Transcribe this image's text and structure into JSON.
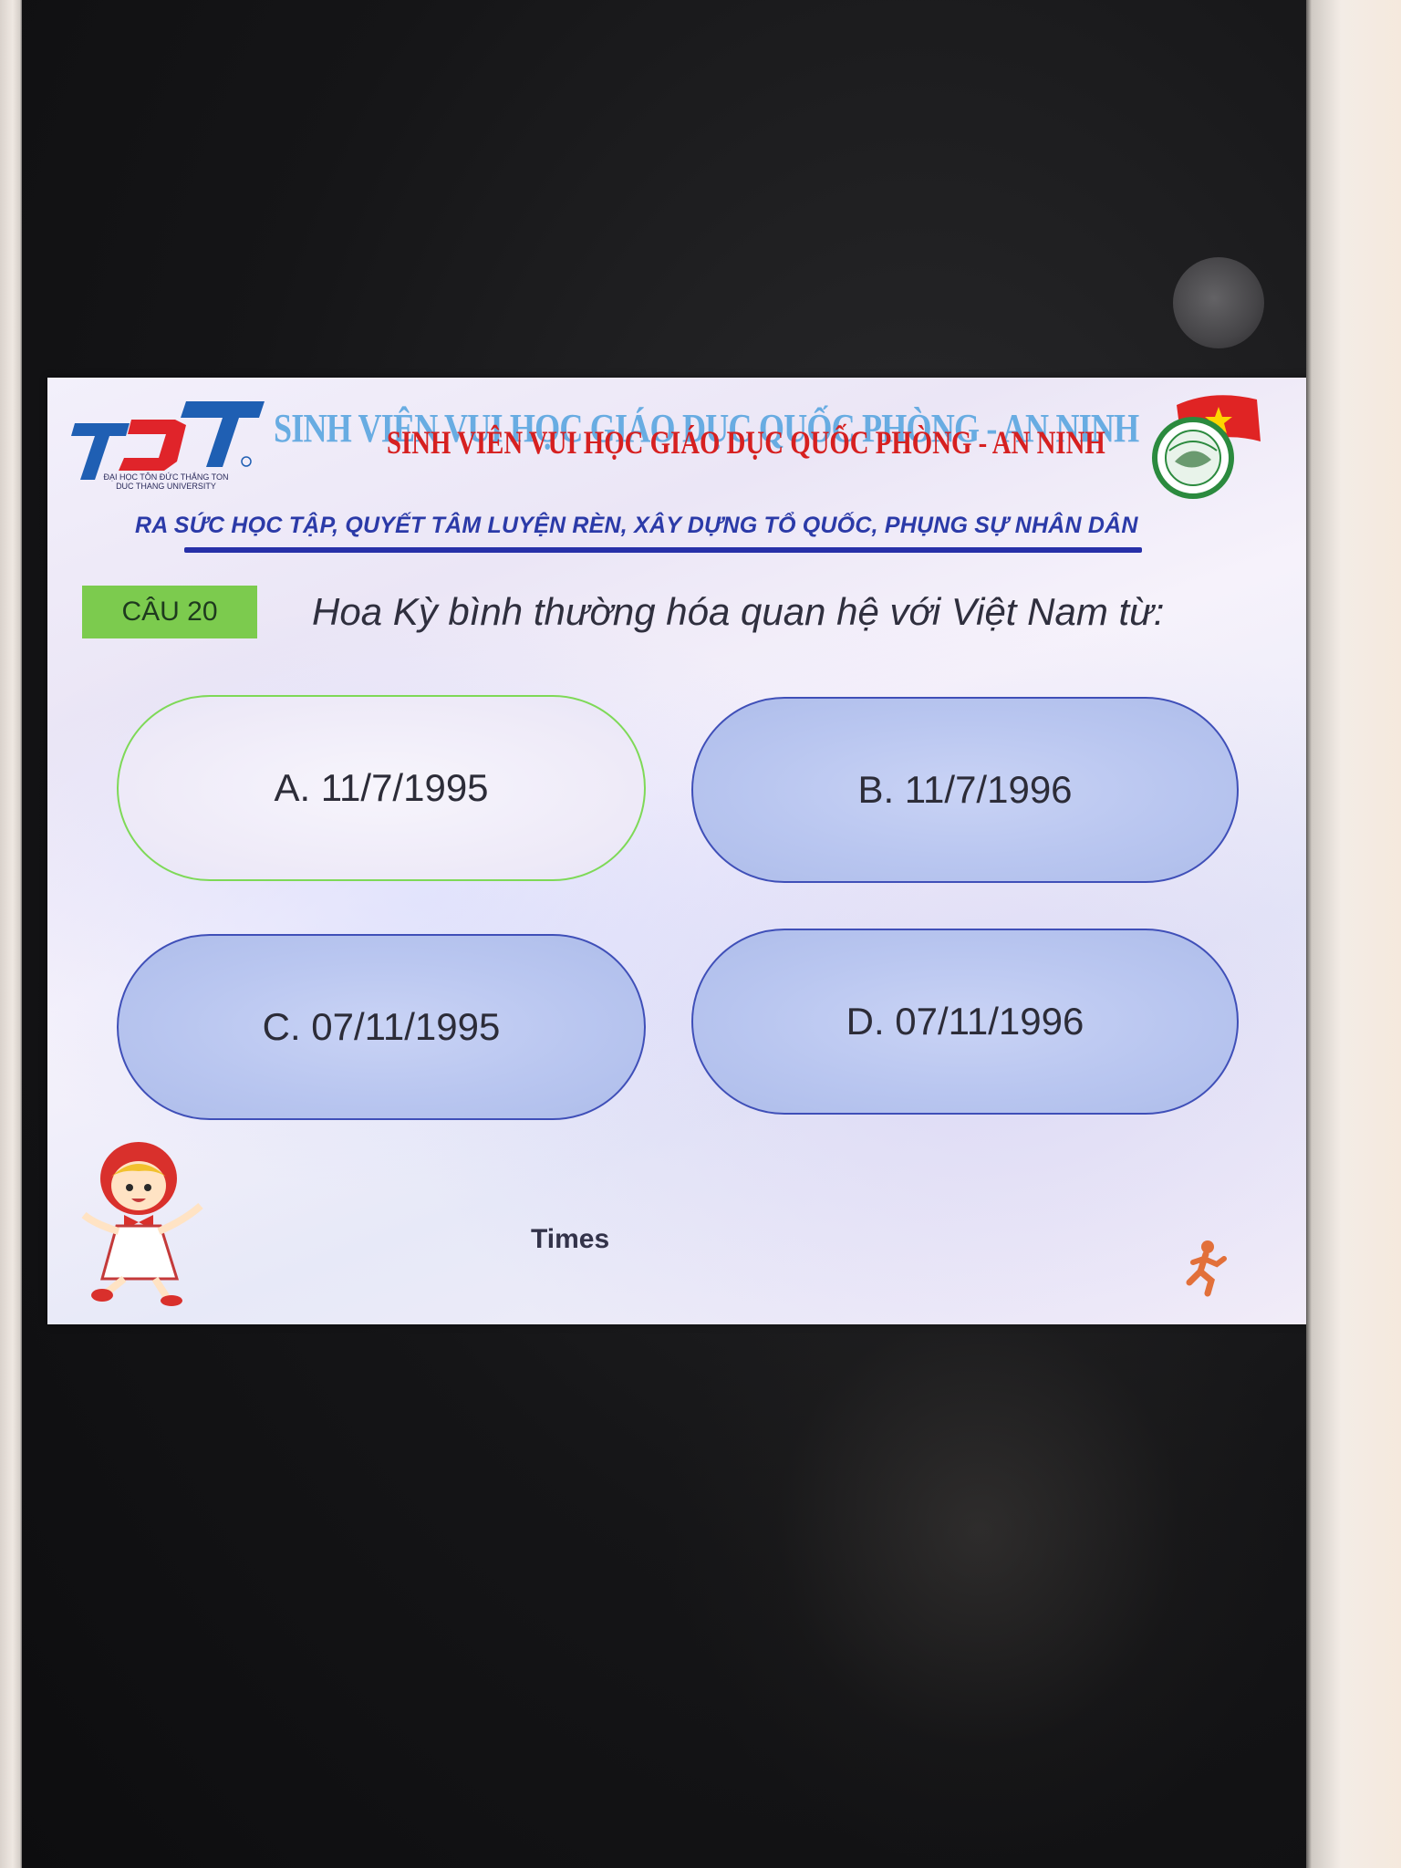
{
  "header": {
    "logo_text": "TĐT",
    "logo_caption": "ĐẠI HỌC TÔN ĐỨC THẮNG TON DUC THANG UNIVERSITY",
    "title_shadow": "SINH VIÊN VUI HỌC GIÁO DỤC QUỐC PHÒNG - AN NINH",
    "title": "SINH VIÊN VUI HỌC GIÁO DỤC QUỐC PHÒNG - AN NINH",
    "slogan": "RA SỨC HỌC TẬP, QUYẾT TÂM LUYỆN RÈN, XÂY DỰNG TỔ QUỐC, PHỤNG SỰ NHÂN DÂN"
  },
  "question": {
    "number_label": "CÂU 20",
    "text": "Hoa Kỳ bình thường hóa quan hệ với Việt Nam từ:"
  },
  "answers": [
    {
      "label": "A. 11/7/1995"
    },
    {
      "label": "B. 11/7/1996"
    },
    {
      "label": "C. 07/11/1995"
    },
    {
      "label": "D. 07/11/1996"
    }
  ],
  "footer": {
    "timer_label": "Times"
  },
  "colors": {
    "qnum_bg": "#7ccb4e",
    "title_red": "#d62020",
    "slogan_blue": "#2b3aa8",
    "answer_fill": "#b9c6f0",
    "selected_border": "#7ed957"
  },
  "icons": {
    "logo": "tdt-university-logo",
    "emblem": "youth-union-emblem-icon",
    "mascot": "girl-mascot-icon",
    "runner": "running-man-icon"
  }
}
